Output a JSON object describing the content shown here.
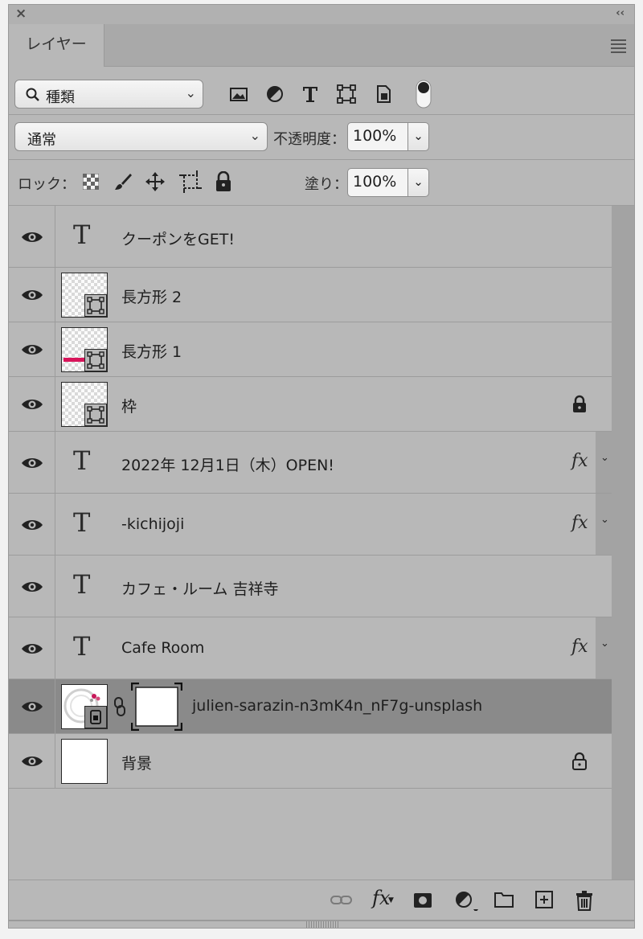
{
  "panel": {
    "close_label": "×",
    "collapse_label": "‹‹",
    "tab_label": "レイヤー"
  },
  "filter": {
    "kind_label": "種類",
    "icons": [
      "image-filter-icon",
      "adjustment-filter-icon",
      "type-filter-icon",
      "shape-filter-icon",
      "smart-object-filter-icon",
      "filter-toggle-icon"
    ]
  },
  "blend": {
    "mode": "通常",
    "opacity_label": "不透明度：",
    "opacity_value": "100%"
  },
  "lock": {
    "lock_label": "ロック：",
    "fill_label": "塗り：",
    "fill_value": "100%"
  },
  "layers": [
    {
      "name": "クーポンをGET!",
      "kind": "text",
      "fx": false,
      "locked": false
    },
    {
      "name": "長方形 2",
      "kind": "shape",
      "fx": false,
      "locked": false
    },
    {
      "name": "長方形 1",
      "kind": "shape",
      "fx": false,
      "locked": false,
      "accent": "#d8145a"
    },
    {
      "name": "枠",
      "kind": "shape",
      "fx": false,
      "locked": true
    },
    {
      "name": "2022年 12月1日（木）OPEN!",
      "kind": "text",
      "fx": true,
      "locked": false
    },
    {
      "name": "-kichijoji",
      "kind": "text",
      "fx": true,
      "locked": false
    },
    {
      "name": "カフェ・ルーム 吉祥寺",
      "kind": "text",
      "fx": false,
      "locked": false
    },
    {
      "name": "Cafe Room",
      "kind": "text",
      "fx": true,
      "locked": false
    },
    {
      "name": "julien-sarazin-n3mK4n_nF7g-unsplash",
      "kind": "smart-object-masked",
      "fx": false,
      "locked": false,
      "selected": true
    },
    {
      "name": "背景",
      "kind": "background",
      "fx": false,
      "locked": true
    }
  ],
  "fx_label": "fx",
  "bottom_icons": [
    "link-layers-icon",
    "add-style-icon",
    "add-mask-icon",
    "new-adjustment-icon",
    "new-group-icon",
    "new-layer-icon",
    "delete-icon"
  ],
  "colors": {
    "panel": "#b8b8b8",
    "selected_row": "#8a8a8a",
    "accent": "#d8145a"
  }
}
